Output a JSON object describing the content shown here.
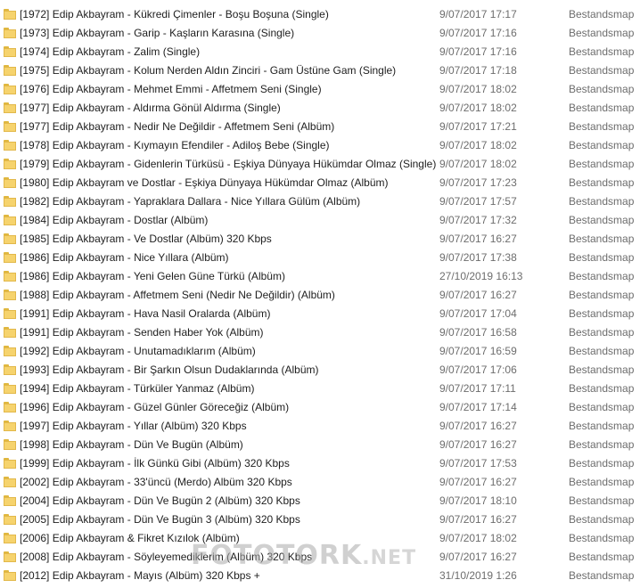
{
  "rows": [
    {
      "name": "[1972] Edip Akbayram - Kükredi Çimenler - Boşu Boşuna (Single)",
      "date": "9/07/2017 17:17",
      "type": "Bestandsmap"
    },
    {
      "name": "[1973] Edip Akbayram - Garip - Kaşların Karasına (Single)",
      "date": "9/07/2017 17:16",
      "type": "Bestandsmap"
    },
    {
      "name": "[1974] Edip Akbayram - Zalim (Single)",
      "date": "9/07/2017 17:16",
      "type": "Bestandsmap"
    },
    {
      "name": "[1975] Edip Akbayram - Kolum Nerden Aldın Zinciri - Gam Üstüne Gam (Single)",
      "date": "9/07/2017 17:18",
      "type": "Bestandsmap"
    },
    {
      "name": "[1976] Edip Akbayram - Mehmet Emmi - Affetmem Seni (Single)",
      "date": "9/07/2017 18:02",
      "type": "Bestandsmap"
    },
    {
      "name": "[1977] Edip Akbayram - Aldırma Gönül Aldırma (Single)",
      "date": "9/07/2017 18:02",
      "type": "Bestandsmap"
    },
    {
      "name": "[1977] Edip Akbayram - Nedir Ne Değildir - Affetmem Seni (Albüm)",
      "date": "9/07/2017 17:21",
      "type": "Bestandsmap"
    },
    {
      "name": "[1978] Edip Akbayram - Kıymayın Efendiler - Adiloş Bebe (Single)",
      "date": "9/07/2017 18:02",
      "type": "Bestandsmap"
    },
    {
      "name": "[1979] Edip Akbayram - Gidenlerin Türküsü - Eşkiya Dünyaya Hükümdar Olmaz (Single)",
      "date": "9/07/2017 18:02",
      "type": "Bestandsmap"
    },
    {
      "name": "[1980] Edip Akbayram ve Dostlar - Eşkiya Dünyaya Hükümdar Olmaz (Albüm)",
      "date": "9/07/2017 17:23",
      "type": "Bestandsmap"
    },
    {
      "name": "[1982] Edip Akbayram - Yapraklara Dallara - Nice Yıllara Gülüm (Albüm)",
      "date": "9/07/2017 17:57",
      "type": "Bestandsmap"
    },
    {
      "name": "[1984] Edip Akbayram - Dostlar (Albüm)",
      "date": "9/07/2017 17:32",
      "type": "Bestandsmap"
    },
    {
      "name": "[1985] Edip Akbayram - Ve Dostlar (Albüm) 320 Kbps",
      "date": "9/07/2017 16:27",
      "type": "Bestandsmap"
    },
    {
      "name": "[1986] Edip Akbayram - Nice Yıllara (Albüm)",
      "date": "9/07/2017 17:38",
      "type": "Bestandsmap"
    },
    {
      "name": "[1986] Edip Akbayram - Yeni Gelen Güne Türkü (Albüm)",
      "date": "27/10/2019 16:13",
      "type": "Bestandsmap"
    },
    {
      "name": "[1988] Edip Akbayram - Affetmem Seni (Nedir Ne Değildir) (Albüm)",
      "date": "9/07/2017 16:27",
      "type": "Bestandsmap"
    },
    {
      "name": "[1991] Edip Akbayram - Hava Nasil Oralarda (Albüm)",
      "date": "9/07/2017 17:04",
      "type": "Bestandsmap"
    },
    {
      "name": "[1991] Edip Akbayram - Senden Haber Yok (Albüm)",
      "date": "9/07/2017 16:58",
      "type": "Bestandsmap"
    },
    {
      "name": "[1992] Edip Akbayram - Unutamadıklarım (Albüm)",
      "date": "9/07/2017 16:59",
      "type": "Bestandsmap"
    },
    {
      "name": "[1993] Edip Akbayram - Bir Şarkın Olsun Dudaklarında (Albüm)",
      "date": "9/07/2017 17:06",
      "type": "Bestandsmap"
    },
    {
      "name": "[1994] Edip Akbayram - Türküler Yanmaz (Albüm)",
      "date": "9/07/2017 17:11",
      "type": "Bestandsmap"
    },
    {
      "name": "[1996] Edip Akbayram - Güzel Günler Göreceğiz (Albüm)",
      "date": "9/07/2017 17:14",
      "type": "Bestandsmap"
    },
    {
      "name": "[1997] Edip Akbayram - Yıllar (Albüm) 320 Kbps",
      "date": "9/07/2017 16:27",
      "type": "Bestandsmap"
    },
    {
      "name": "[1998] Edip Akbayram - Dün Ve Bugün (Albüm)",
      "date": "9/07/2017 16:27",
      "type": "Bestandsmap"
    },
    {
      "name": "[1999] Edip Akbayram - İlk Günkü Gibi (Albüm) 320 Kbps",
      "date": "9/07/2017 17:53",
      "type": "Bestandsmap"
    },
    {
      "name": "[2002] Edip Akbayram - 33'üncü (Merdo) Albüm 320 Kbps",
      "date": "9/07/2017 16:27",
      "type": "Bestandsmap"
    },
    {
      "name": "[2004] Edip Akbayram - Dün Ve Bugün 2 (Albüm) 320 Kbps",
      "date": "9/07/2017 18:10",
      "type": "Bestandsmap"
    },
    {
      "name": "[2005] Edip Akbayram - Dün Ve Bugün 3 (Albüm) 320 Kbps",
      "date": "9/07/2017 16:27",
      "type": "Bestandsmap"
    },
    {
      "name": "[2006] Edip Akbayram & Fikret Kızılok (Albüm)",
      "date": "9/07/2017 18:02",
      "type": "Bestandsmap"
    },
    {
      "name": "[2008] Edip Akbayram - Söyleyemediklerim (Albüm) 320 Kbps",
      "date": "9/07/2017 16:27",
      "type": "Bestandsmap"
    },
    {
      "name": "[2012] Edip Akbayram - Mayıs (Albüm) 320 Kbps +",
      "date": "31/10/2019 1:26",
      "type": "Bestandsmap"
    }
  ],
  "watermark": {
    "brand": "FOTOTORK",
    "ext": ".NET"
  },
  "colors": {
    "folder": "#f6d36d",
    "folder_border": "#e2b84a",
    "meta_text": "#6d6d6d"
  },
  "icons": {
    "row_icon": "folder-icon"
  }
}
